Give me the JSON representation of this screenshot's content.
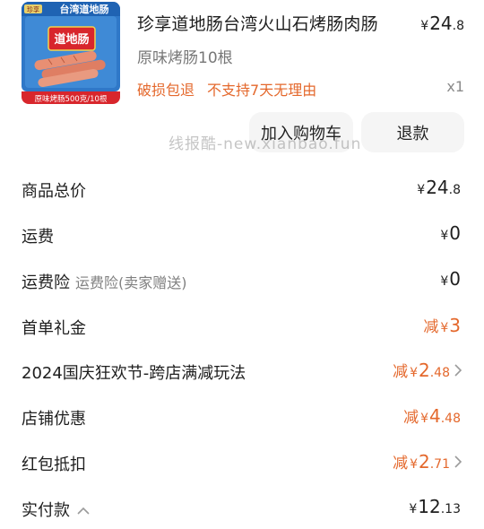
{
  "product": {
    "image": {
      "brand_badge": "珍享",
      "banner": "台湾道地肠",
      "logo": "道地肠",
      "caption": "原味烤肠500克/10根"
    },
    "title": "珍享道地肠台湾火山石烤肠肉肠",
    "spec": "原味烤肠10根",
    "tags": [
      "破损包退",
      "不支持7天无理由"
    ],
    "price_yen": "¥",
    "price_int": "24",
    "price_dec": ".8",
    "quantity": "x1"
  },
  "actions": {
    "add_to_cart": "加入购物车",
    "refund": "退款"
  },
  "watermark": "线报酷-new.xianbao.fun",
  "summary": {
    "goods_total": {
      "label": "商品总价",
      "yen": "¥",
      "int": "24",
      "dec": ".8"
    },
    "shipping": {
      "label": "运费",
      "yen": "¥",
      "int": "0",
      "dec": ""
    },
    "shipping_insurance": {
      "label": "运费险",
      "sub": "运费险(卖家赠送)",
      "yen": "¥",
      "int": "0",
      "dec": ""
    },
    "first_order_gift": {
      "label": "首单礼金",
      "prefix": "减",
      "yen": "¥",
      "int": "3",
      "dec": ""
    },
    "festival_promo": {
      "label": "2024国庆狂欢节-跨店满减玩法",
      "prefix": "减",
      "yen": "¥",
      "int": "2",
      "dec": ".48"
    },
    "store_discount": {
      "label": "店铺优惠",
      "prefix": "减",
      "yen": "¥",
      "int": "4",
      "dec": ".48"
    },
    "red_packet": {
      "label": "红包抵扣",
      "prefix": "减",
      "yen": "¥",
      "int": "2",
      "dec": ".71"
    },
    "actual_paid": {
      "label": "实付款",
      "yen": "¥",
      "int": "12",
      "dec": ".13"
    }
  },
  "colors": {
    "accent_orange": "#e4682c",
    "text_primary": "#1e1e1e",
    "text_secondary": "#777777",
    "button_bg": "#f5f5f5",
    "package_blue": "#2f78c8",
    "package_red": "#d8262c"
  },
  "icons": [
    "chevron-right-icon",
    "chevron-up-icon"
  ]
}
